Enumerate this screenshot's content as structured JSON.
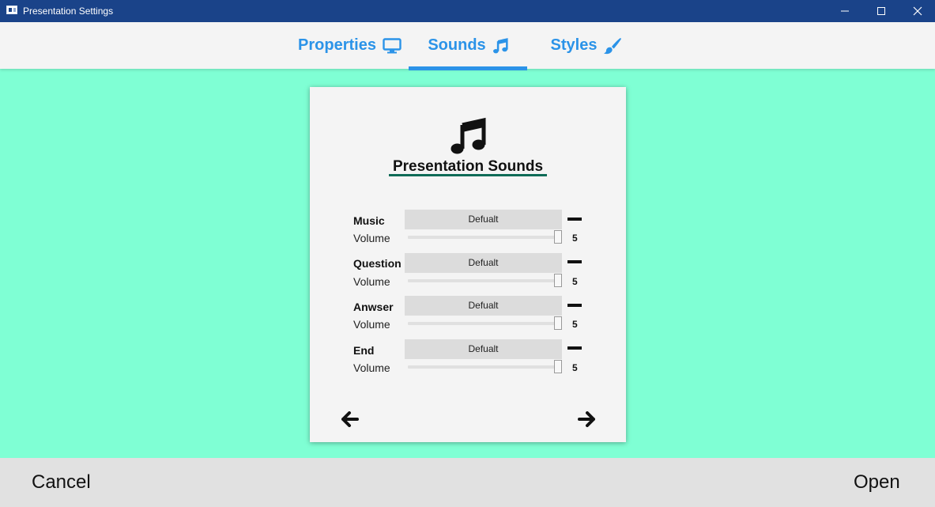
{
  "window": {
    "title": "Presentation Settings"
  },
  "tabs": [
    {
      "label": "Properties",
      "icon": "monitor-icon"
    },
    {
      "label": "Sounds",
      "icon": "music-note-icon",
      "selected": true
    },
    {
      "label": "Styles",
      "icon": "paintbrush-icon"
    }
  ],
  "card": {
    "title": "Presentation Sounds",
    "icon": "music-note-icon",
    "rows": [
      {
        "label": "Music",
        "select_value": "Defualt",
        "volume_label": "Volume",
        "volume": "5",
        "volume_max": 5
      },
      {
        "label": "Question",
        "select_value": "Defualt",
        "volume_label": "Volume",
        "volume": "5",
        "volume_max": 5
      },
      {
        "label": "Anwser",
        "select_value": "Defualt",
        "volume_label": "Volume",
        "volume": "5",
        "volume_max": 5
      },
      {
        "label": "End",
        "select_value": "Defualt",
        "volume_label": "Volume",
        "volume": "5",
        "volume_max": 5
      }
    ],
    "nav": {
      "prev_icon": "arrow-left-icon",
      "next_icon": "arrow-right-icon"
    }
  },
  "footer": {
    "cancel_label": "Cancel",
    "open_label": "Open"
  },
  "colors": {
    "titlebar": "#1a4389",
    "accent": "#2b93e8",
    "background": "#7fffd4",
    "title_underline": "#0f6b57"
  }
}
